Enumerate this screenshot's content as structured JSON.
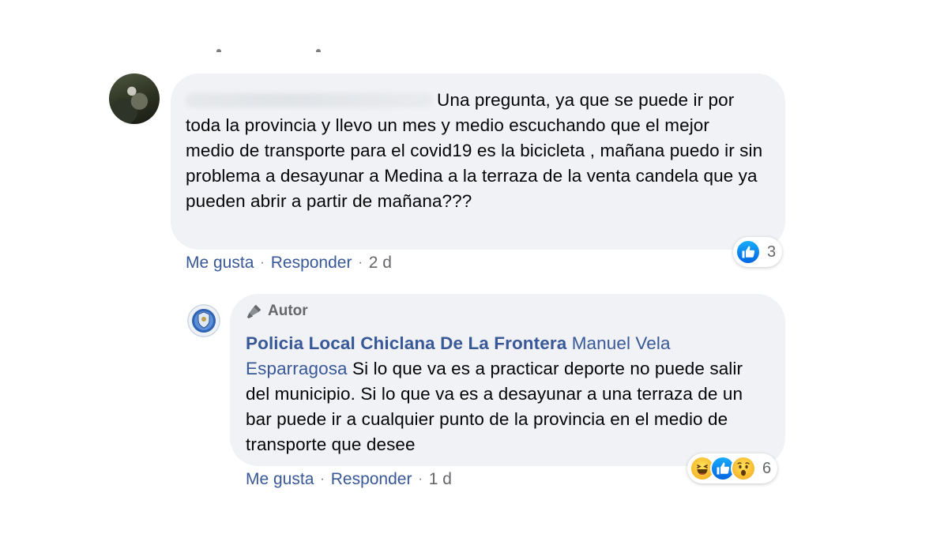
{
  "comment1": {
    "text": "Una pregunta, ya que se puede ir por toda la provincia y llevo un mes y medio escuchando que el mejor medio de transporte para el covid19 es la bicicleta , mañana puedo ir sin problema a desayunar a Medina a la terraza de la venta candela que ya pueden abrir a partir de mañana???",
    "like_label": "Me gusta",
    "reply_label": "Responder",
    "time": "2 d",
    "reaction_count": "3",
    "reaction_icons": [
      "like-icon"
    ]
  },
  "comment2": {
    "badge_label": "Autor",
    "author": "Policia Local Chiclana De La Frontera",
    "mention": "Manuel Vela Esparragosa",
    "text": "Si lo que va es a practicar deporte no puede salir del municipio. Si lo que va es a desayunar a una terraza de un bar puede ir a cualquier punto de la provincia en el medio de transporte que desee",
    "like_label": "Me gusta",
    "reply_label": "Responder",
    "time": "1 d",
    "reaction_count": "6",
    "reaction_icons": [
      "haha-icon",
      "like-icon",
      "wow-icon"
    ]
  },
  "colors": {
    "link": "#385898",
    "bubble": "#f0f2f5",
    "meta": "#65676b",
    "like": "#1877f2"
  }
}
